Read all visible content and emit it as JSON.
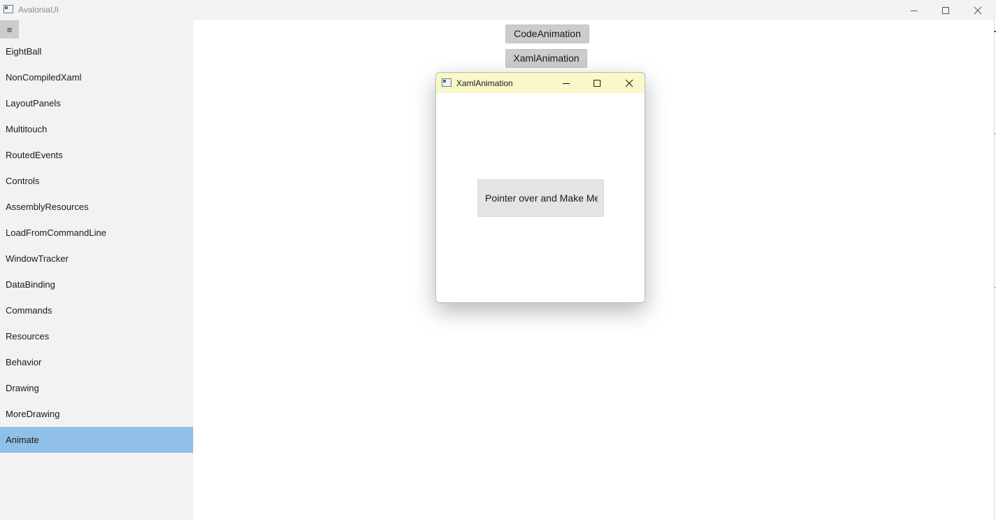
{
  "window": {
    "title": "AvaloniaUI"
  },
  "sidebar": {
    "menu_glyph": "≡",
    "items": [
      {
        "label": "EightBall"
      },
      {
        "label": "NonCompiledXaml"
      },
      {
        "label": "LayoutPanels"
      },
      {
        "label": "Multitouch"
      },
      {
        "label": "RoutedEvents"
      },
      {
        "label": "Controls"
      },
      {
        "label": "AssemblyResources"
      },
      {
        "label": "LoadFromCommandLine"
      },
      {
        "label": "WindowTracker"
      },
      {
        "label": "DataBinding"
      },
      {
        "label": "Commands"
      },
      {
        "label": "Resources"
      },
      {
        "label": "Behavior"
      },
      {
        "label": "Drawing"
      },
      {
        "label": "MoreDrawing"
      },
      {
        "label": "Animate"
      }
    ],
    "selected_label": "Animate"
  },
  "main": {
    "code_animation_label": "CodeAnimation",
    "xaml_animation_label": "XamlAnimation"
  },
  "child_window": {
    "title": "XamlAnimation",
    "button_label": "Pointer over and Make Me Spin"
  },
  "colors": {
    "selected_item": "#90c0e8",
    "child_titlebar": "#faf7c8",
    "accent_edge": "#1a73d0"
  },
  "icons": {
    "app": "app-window-icon",
    "minimize": "minimize-icon",
    "maximize": "maximize-icon",
    "close": "close-icon",
    "menu": "hamburger-menu-icon"
  }
}
